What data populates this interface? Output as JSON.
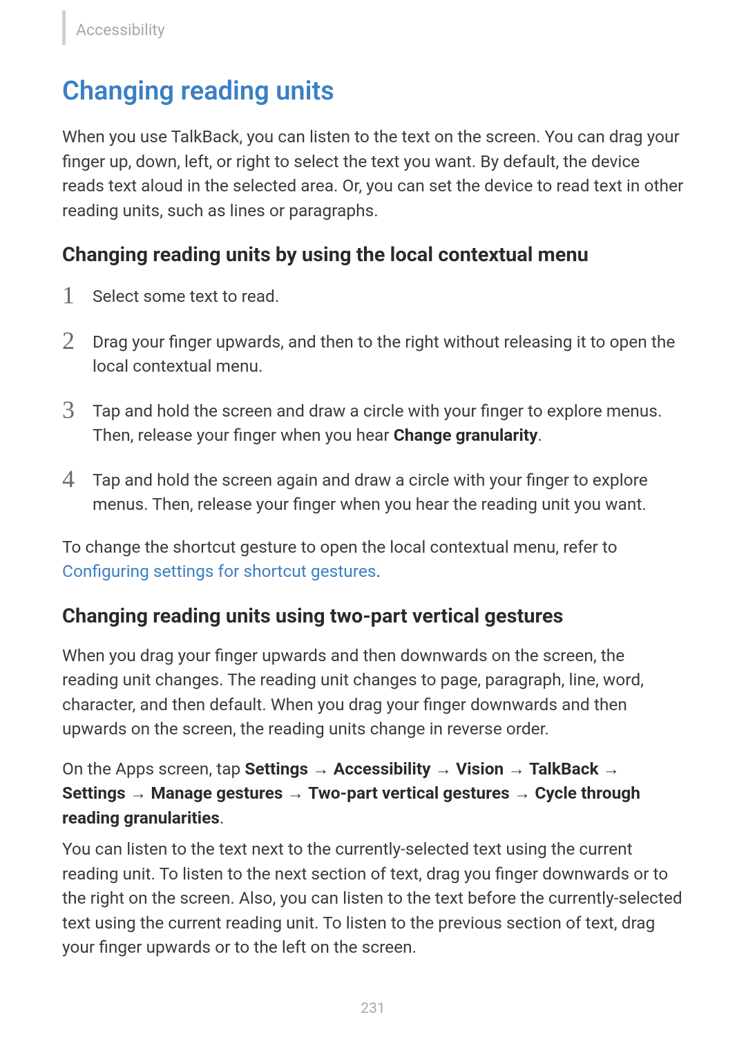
{
  "breadcrumb": "Accessibility",
  "heading": "Changing reading units",
  "intro": "When you use TalkBack, you can listen to the text on the screen. You can drag your finger up, down, left, or right to select the text you want. By default, the device reads text aloud in the selected area. Or, you can set the device to read text in other reading units, such as lines or paragraphs.",
  "section1": {
    "title": "Changing reading units by using the local contextual menu",
    "steps": {
      "n1": "1",
      "t1": "Select some text to read.",
      "n2": "2",
      "t2": "Drag your finger upwards, and then to the right without releasing it to open the local contextual menu.",
      "n3": "3",
      "t3_a": "Tap and hold the screen and draw a circle with your finger to explore menus. Then, release your finger when you hear ",
      "t3_b": "Change granularity",
      "t3_c": ".",
      "n4": "4",
      "t4": "Tap and hold the screen again and draw a circle with your finger to explore menus. Then, release your finger when you hear the reading unit you want."
    },
    "ref_a": "To change the shortcut gesture to open the local contextual menu, refer to ",
    "ref_link": "Configuring settings for shortcut gestures",
    "ref_c": "."
  },
  "section2": {
    "title": "Changing reading units using two-part vertical gestures",
    "p1": "When you drag your finger upwards and then downwards on the screen, the reading unit changes. The reading unit changes to page, paragraph, line, word, character, and then default. When you drag your finger downwards and then upwards on the screen, the reading units change in reverse order.",
    "path": {
      "prefix": "On the Apps screen, tap ",
      "s": "Settings",
      "a": "Accessibility",
      "v": "Vision",
      "t": "TalkBack",
      "s2": "Settings",
      "mg": "Manage gestures",
      "tp": "Two-part vertical gestures",
      "c": "Cycle through reading granularities",
      "arrow": " → ",
      "dot": "."
    },
    "p3": "You can listen to the text next to the currently-selected text using the current reading unit. To listen to the next section of text, drag you finger downwards or to the right on the screen. Also, you can listen to the text before the currently-selected text using the current reading unit. To listen to the previous section of text, drag your finger upwards or to the left on the screen."
  },
  "page_number": "231"
}
